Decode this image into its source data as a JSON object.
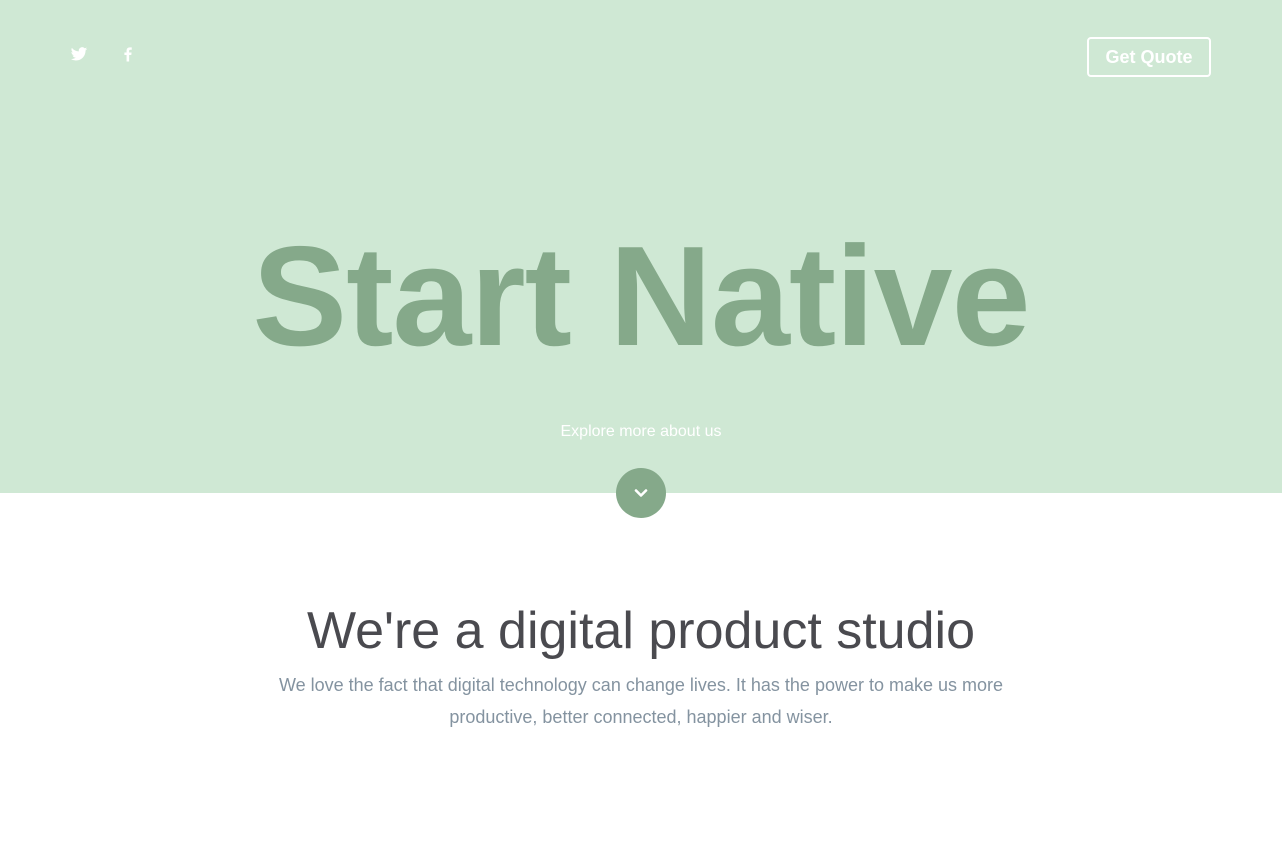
{
  "header": {
    "social": [
      {
        "icon": "twitter-icon"
      },
      {
        "icon": "facebook-icon"
      }
    ],
    "quote_label": "Get Quote"
  },
  "hero": {
    "title": "Start Native",
    "explore_label": "Explore more about us",
    "down_icon": "chevron-down-icon"
  },
  "intro": {
    "title": "We're a digital product studio",
    "text": "We love the fact that digital technology can change lives. It has the power to make us more productive, better connected, happier and wiser."
  },
  "colors": {
    "hero_background": "#cfe8d4",
    "accent": "#85a98a",
    "heading": "#4a4a4f",
    "body_text": "#8493a0"
  }
}
